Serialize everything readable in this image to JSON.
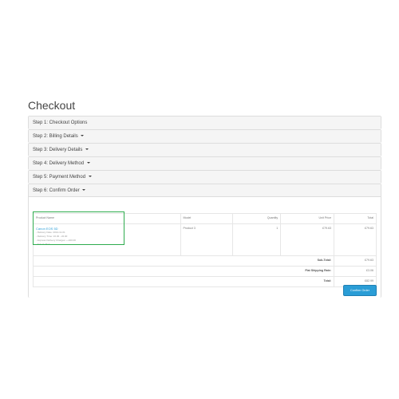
{
  "page": {
    "title": "Checkout"
  },
  "steps": [
    {
      "label": "Step 1: Checkout Options",
      "has_caret": false
    },
    {
      "label": "Step 2: Billing Details",
      "has_caret": true
    },
    {
      "label": "Step 3: Delivery Details",
      "has_caret": true
    },
    {
      "label": "Step 4: Delivery Method",
      "has_caret": true
    },
    {
      "label": "Step 5: Payment Method",
      "has_caret": true
    },
    {
      "label": "Step 6: Confirm Order",
      "has_caret": true
    }
  ],
  "cart": {
    "headers": {
      "product": "Product Name",
      "model": "Model",
      "quantity": "Quantity",
      "unit_price": "Unit Price",
      "total": "Total"
    },
    "items": [
      {
        "name": "Canon EOS 5D",
        "options": [
          "- Delivery Date: 2012-11-01",
          "- Delivery Time: 16.30 - 22.00",
          "- Express Delivery Charges: + £30.00",
          "- Select: Red"
        ],
        "model": "Product 3",
        "quantity": "1",
        "unit_price": "£79.63",
        "total": "£79.63"
      }
    ],
    "totals": [
      {
        "label": "Sub-Total:",
        "value": "£79.63"
      },
      {
        "label": "Flat Shipping Rate:",
        "value": "£3.06"
      },
      {
        "label": "Total:",
        "value": "£82.99"
      }
    ]
  },
  "actions": {
    "confirm_label": "Confirm Order"
  },
  "colors": {
    "accent": "#2a9dd6",
    "highlight": "#2eac4e",
    "panel_heading_bg": "#f5f5f5",
    "border": "#dddddd"
  }
}
